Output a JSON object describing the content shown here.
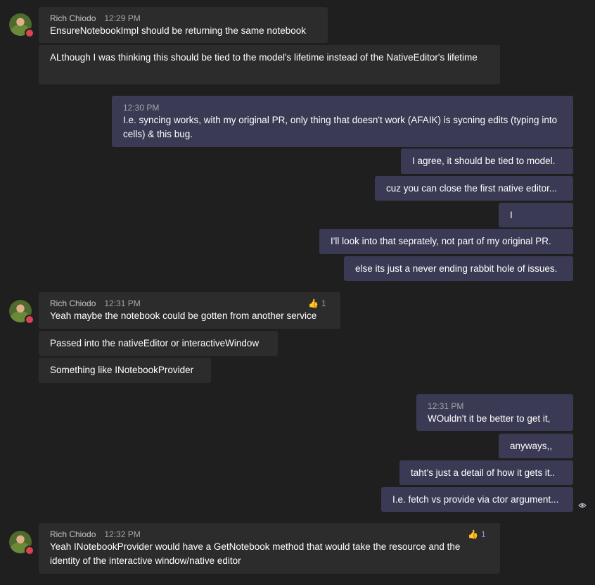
{
  "conversation": {
    "group1": {
      "sender": "Rich Chiodo",
      "time": "12:29 PM",
      "messages": [
        "EnsureNotebookImpl should be returning the same notebook",
        "ALthough I was thinking this should be tied to the model's lifetime instead of the NativeEditor's lifetime"
      ]
    },
    "group2": {
      "time": "12:30 PM",
      "messages": [
        "I.e. syncing works, with my original PR, only thing that doesn't work (AFAIK) is sycning edits (typing into cells) & this bug.",
        "I agree, it should be tied to model.",
        "cuz you can close the first native editor...",
        "I",
        "I'll look into that seprately, not part of my original PR.",
        "else its just a never ending rabbit hole of issues."
      ]
    },
    "group3": {
      "sender": "Rich Chiodo",
      "time": "12:31 PM",
      "reaction": {
        "icon": "thumbs-up-icon",
        "count": "1"
      },
      "messages": [
        "Yeah maybe the notebook could be gotten from another service",
        "Passed into the nativeEditor or interactiveWindow",
        "Something like INotebookProvider"
      ]
    },
    "group4": {
      "time": "12:31 PM",
      "messages": [
        "WOuldn't it be better to get it,",
        "anyways,,",
        "taht's just a detail of how it gets it..",
        "I.e. fetch vs provide via ctor argument..."
      ],
      "seen_icon": "eye-icon"
    },
    "group5": {
      "sender": "Rich Chiodo",
      "time": "12:32 PM",
      "reaction": {
        "icon": "thumbs-up-icon",
        "count": "1"
      },
      "messages": [
        "Yeah INotebookProvider would have a GetNotebook method that would take the resource and the identity of the interactive window/native editor"
      ]
    }
  },
  "colors": {
    "background": "#1f1f1f",
    "incoming_bubble": "#2d2c2c",
    "outgoing_bubble": "#3a3a54",
    "presence_busy": "#d9444f",
    "reaction_count": "#8a9bd8"
  }
}
